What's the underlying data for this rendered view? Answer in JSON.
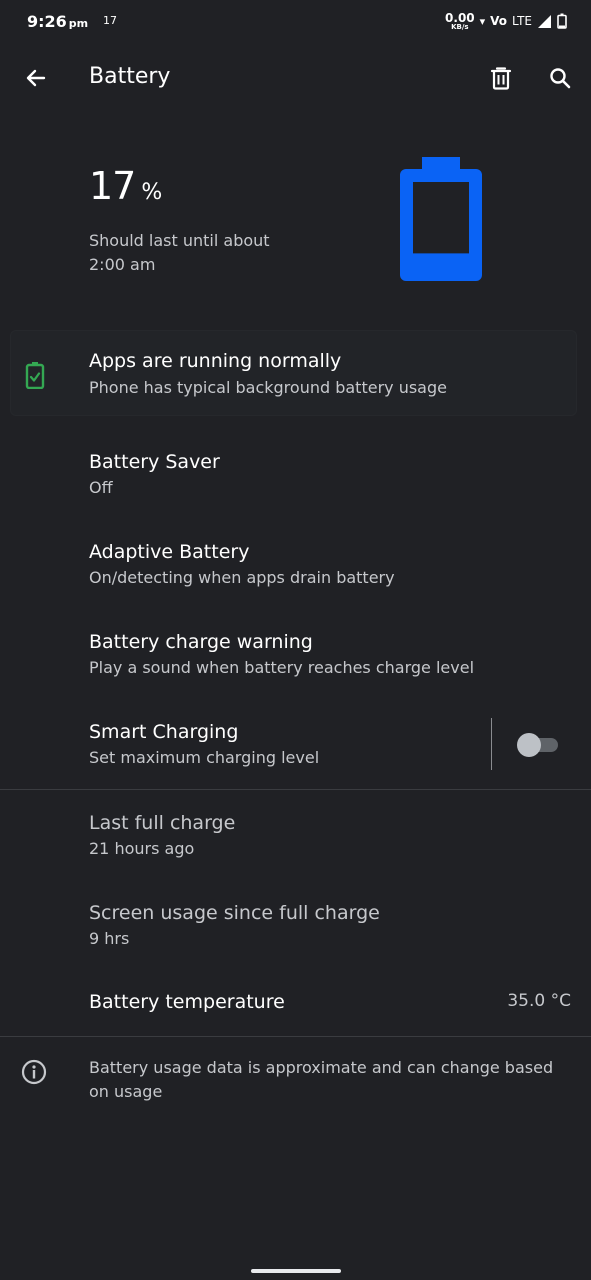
{
  "status_bar": {
    "time": "9:26",
    "ampm": "pm",
    "notification_count": "17",
    "net_speed": "0.00",
    "net_unit": "KB/s",
    "volte": "Vo",
    "network": "LTE"
  },
  "app_bar": {
    "title": "Battery",
    "icons": [
      "back-arrow-icon",
      "trash-icon",
      "search-icon"
    ]
  },
  "battery": {
    "level_text": "17",
    "percent_sign": "%",
    "level": 17,
    "estimate_line1": "Should last until about",
    "estimate_line2": "2:00 am",
    "accent_color": "#0a63f5"
  },
  "tip": {
    "title": "Apps are running normally",
    "subtitle": "Phone has typical background battery usage",
    "icon_color": "#34a853"
  },
  "preferences": [
    {
      "title": "Battery Saver",
      "summary": "Off"
    },
    {
      "title": "Adaptive Battery",
      "summary": "On/detecting when apps drain battery"
    },
    {
      "title": "Battery charge warning",
      "summary": "Play a sound when battery reaches charge level"
    },
    {
      "title": "Smart Charging",
      "summary": "Set maximum charging level",
      "toggle_on": false
    }
  ],
  "usage": {
    "last_full_charge_title": "Last full charge",
    "last_full_charge_value": "21 hours ago",
    "screen_usage_title": "Screen usage since full charge",
    "screen_usage_value": "9 hrs",
    "temperature_title": "Battery temperature",
    "temperature_value": "35.0 °C"
  },
  "footer": {
    "text": "Battery usage data is approximate and can change based on usage"
  }
}
